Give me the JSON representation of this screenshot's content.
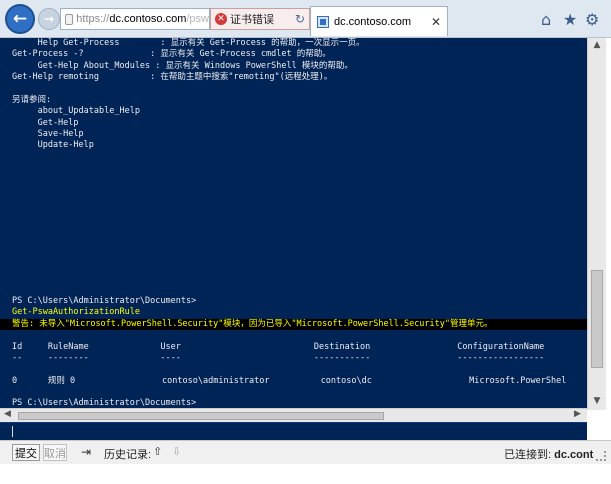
{
  "browser": {
    "url_prefix": "https://",
    "url_domain": "dc.contoso.com",
    "url_tail": "/psw",
    "cert_error": "证书错误",
    "tab_title": "dc.contoso.com"
  },
  "console": {
    "help_lines": [
      "     Help Get-Process        : 显示有关 Get-Process 的帮助，一次显示一页。",
      "Get-Process -?             : 显示有关 Get-Process cmdlet 的帮助。",
      "     Get-Help About_Modules : 显示有关 Windows PowerShell 模块的帮助。",
      "Get-Help remoting          : 在帮助主题中搜索\"remoting\"(远程处理)。"
    ],
    "see_also_header": "另请参阅:",
    "see_also": [
      "     about_Updatable_Help",
      "     Get-Help",
      "     Save-Help",
      "     Update-Help"
    ],
    "prompt1": "PS C:\\Users\\Administrator\\Documents>",
    "command": "Get-PswaAuthorizationRule",
    "warning": "警告: 未导入\"Microsoft.PowerShell.Security\"模块，因为已导入\"Microsoft.PowerShell.Security\"管理单元。",
    "table_header": "Id     RuleName              User                          Destination                 ConfigurationName",
    "table_rule": "--     --------              ----                          -----------                 -----------------",
    "table_row": "0      规则 0                 contoso\\administrator          contoso\\dc                   Microsoft.PowerShel",
    "prompt2": "PS C:\\Users\\Administrator\\Documents>"
  },
  "bottom_bar": {
    "submit_label": "提交",
    "cancel_label": "取消",
    "history_label": "历史记录:",
    "connected_label": "已连接到: ",
    "connected_host": "dc.cont"
  }
}
